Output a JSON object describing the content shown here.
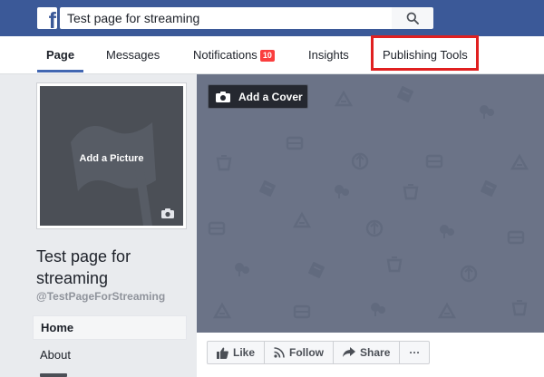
{
  "header": {
    "logo_letter": "f",
    "search_value": "Test page for streaming"
  },
  "tabs": [
    {
      "label": "Page",
      "active": true
    },
    {
      "label": "Messages"
    },
    {
      "label": "Notifications",
      "badge": "10"
    },
    {
      "label": "Insights"
    },
    {
      "label": "Publishing Tools",
      "highlighted": true
    }
  ],
  "profile": {
    "add_picture_label": "Add a Picture",
    "page_name": "Test page for streaming",
    "handle": "@TestPageForStreaming"
  },
  "left_nav": {
    "items": [
      {
        "label": "Home",
        "active": true
      },
      {
        "label": "About"
      }
    ]
  },
  "cover": {
    "add_cover_label": "Add a Cover"
  },
  "actions": {
    "like_label": "Like",
    "follow_label": "Follow",
    "share_label": "Share",
    "more_label": "···"
  },
  "colors": {
    "brand_blue": "#3b5998",
    "notification_badge": "#fa3e3e",
    "highlight_red": "#e02020",
    "cover_gray": "#6b7387"
  }
}
